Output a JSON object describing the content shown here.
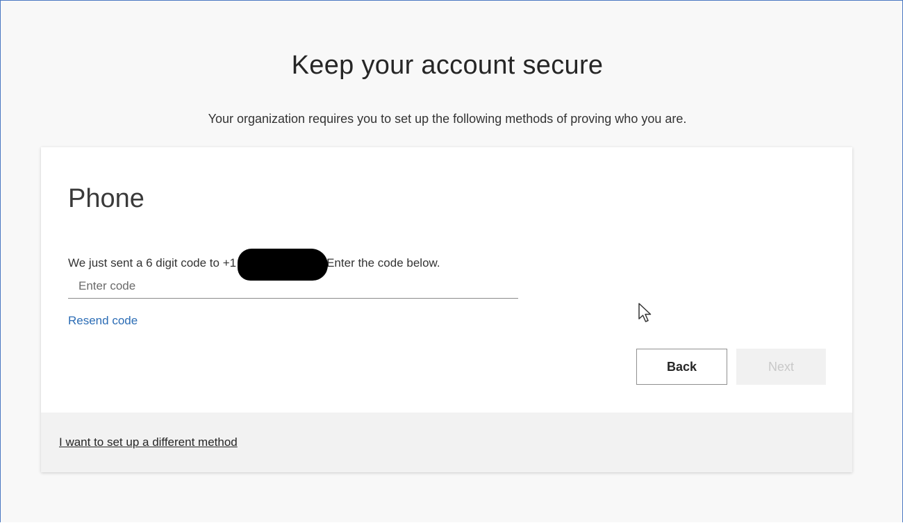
{
  "page": {
    "title": "Keep your account secure",
    "subtitle": "Your organization requires you to set up the following methods of proving who you are."
  },
  "card": {
    "method_title": "Phone",
    "instruction_prefix": "We just sent a 6 digit code to +1",
    "instruction_suffix": "Enter the code below.",
    "code_input": {
      "value": "",
      "placeholder": "Enter code"
    },
    "resend_label": "Resend code",
    "back_label": "Back",
    "next_label": "Next",
    "different_method_label": "I want to set up a different method"
  },
  "icons": {
    "cursor": "mouse-pointer-icon"
  },
  "colors": {
    "link": "#2b6cb5",
    "frame_border": "#4a78c2",
    "footer_bg": "#f2f2f2",
    "disabled_button_bg": "#f1f1f1"
  }
}
